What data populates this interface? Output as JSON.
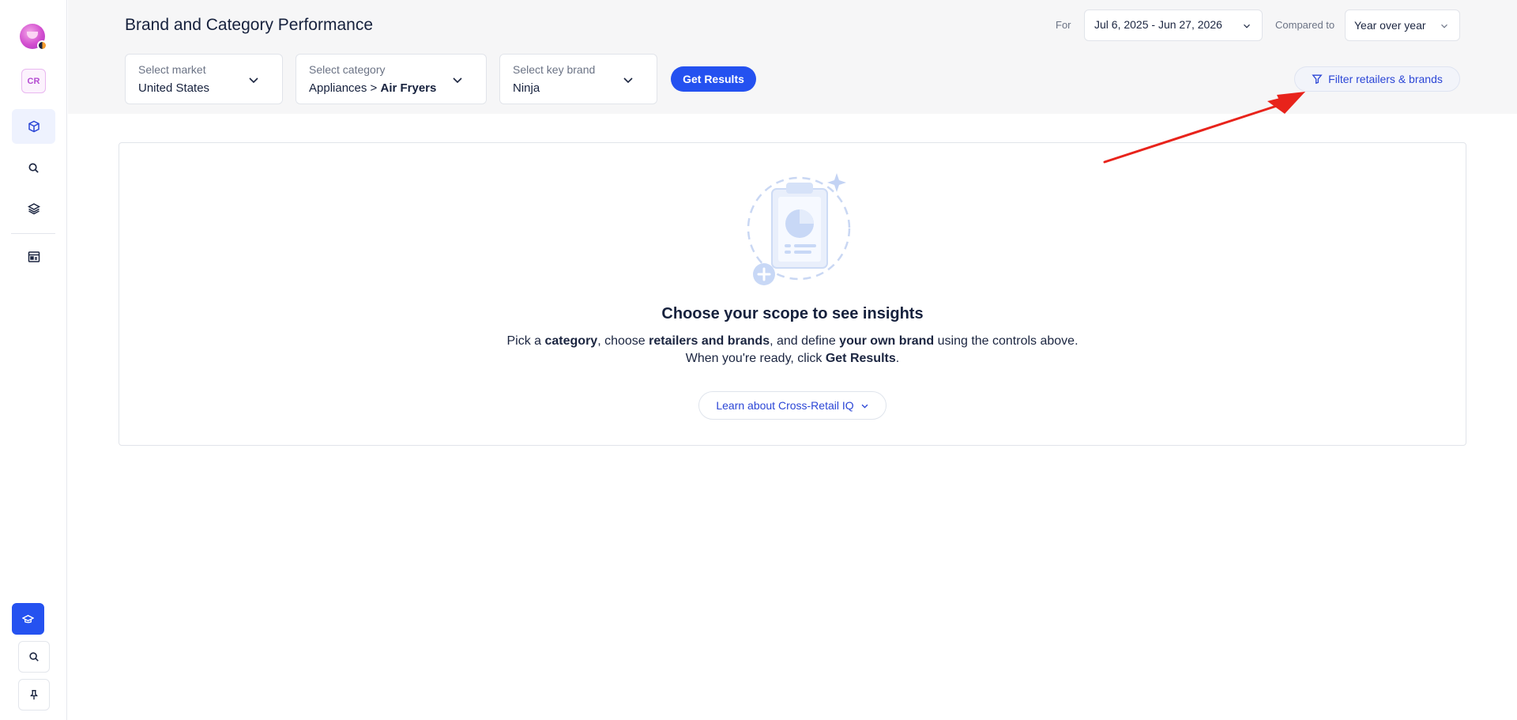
{
  "sidebar": {
    "workspace_badge": "CR",
    "nav_items": [
      {
        "icon": "cube-icon",
        "active": true
      },
      {
        "icon": "search-icon",
        "active": false
      },
      {
        "icon": "layers-icon",
        "active": false
      },
      {
        "icon": "dashboard-icon",
        "active": false
      }
    ],
    "footer_items": [
      {
        "icon": "graduation-cap-icon"
      },
      {
        "icon": "search-icon"
      },
      {
        "icon": "pin-icon"
      }
    ]
  },
  "header": {
    "title": "Brand and Category Performance",
    "for_label": "For",
    "date_range": "Jul 6, 2025 - Jun 27, 2026",
    "compared_label": "Compared to",
    "compared_value": "Year over year",
    "market": {
      "label": "Select market",
      "value": "United States"
    },
    "category": {
      "label": "Select category",
      "value_prefix": "Appliances > ",
      "value_bold": "Air Fryers"
    },
    "brand": {
      "label": "Select key brand",
      "value": "Ninja"
    },
    "get_results_label": "Get Results",
    "filter_label": "Filter retailers & brands"
  },
  "empty_state": {
    "title": "Choose your scope to see insights",
    "line1": {
      "t1": "Pick a ",
      "b1": "category",
      "t2": ", choose ",
      "b2": "retailers and brands",
      "t3": ", and define ",
      "b3": "your own brand",
      "t4": " using the controls above."
    },
    "line2": {
      "t1": "When you're ready, click ",
      "b1": "Get Results",
      "t2": "."
    },
    "learn_label": "Learn about Cross-Retail IQ"
  },
  "colors": {
    "accent": "#2451f0",
    "annotation_arrow": "#e8231b"
  }
}
